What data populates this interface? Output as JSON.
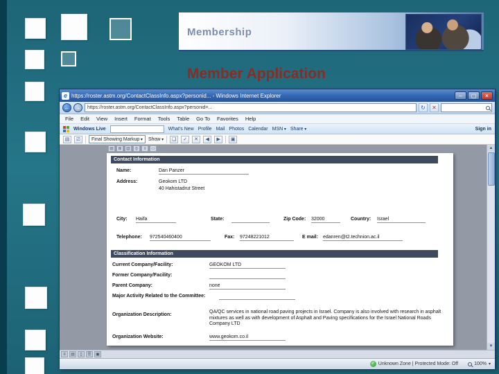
{
  "slide": {
    "banner_title": "Membership",
    "heading": "Member Application"
  },
  "colors": {
    "slide_teal": "#247386",
    "heading_red": "#8c2b21",
    "titlebar_blue": "#3568b4",
    "status_green": "#2e9e3a"
  },
  "browser": {
    "title": "https://roster.astm.org/ContactClassInfo.aspx?personid... - Windows Internet Explorer",
    "address_url": "https://roster.astm.org/ContactClassInfo.aspx?personid=...",
    "menu": [
      "File",
      "Edit",
      "View",
      "Insert",
      "Format",
      "Tools",
      "Table",
      "Go To",
      "Favorites",
      "Help"
    ],
    "live": {
      "brand": "Windows Live",
      "links": [
        "What's New",
        "Profile",
        "Mail",
        "Photos",
        "Calendar",
        "MSN",
        "Share"
      ],
      "sign_in": "Sign in"
    },
    "review": {
      "markup": "Final Showing Markup",
      "show": "Show"
    },
    "status": {
      "zone": "Unknown Zone | Protected Mode: Off",
      "zoom": "100%"
    }
  },
  "form": {
    "contact_section": "Contact Information",
    "fields": {
      "name_label": "Name:",
      "name": "Dan Panzer",
      "address_label": "Address:",
      "address1": "Geokom LTD",
      "address2": "40 Hahistadrut Street",
      "city_label": "City:",
      "city": "Haifa",
      "state_label": "State:",
      "state": "",
      "zip_label": "Zip Code:",
      "zip": "32000",
      "country_label": "Country:",
      "country": "Israel",
      "phone_label": "Telephone:",
      "phone": "972540460400",
      "fax_label": "Fax:",
      "fax": "97248221012",
      "email_label": "E mail:",
      "email": "edanren@t2.technion.ac.il"
    },
    "classification_section": "Classification Information",
    "classification": {
      "current_label": "Current Company/Facility:",
      "current": "GEOKOM LTD",
      "former_label": "Former Company/Facility:",
      "former": "",
      "parent_label": "Parent Company:",
      "parent": "none",
      "activity_label": "Major Activity Related to the Committee:",
      "activity": "",
      "desc_label": "Organization Description:",
      "desc": "QA/QC services in national road paving projects in Israel. Company is also involved with research in asphalt mixtures as well as with development of Asphalt and Paving specifications for the Israel National Roads Company LTD",
      "website_label": "Organization Website:",
      "website": "www.geokom.co.il"
    }
  }
}
